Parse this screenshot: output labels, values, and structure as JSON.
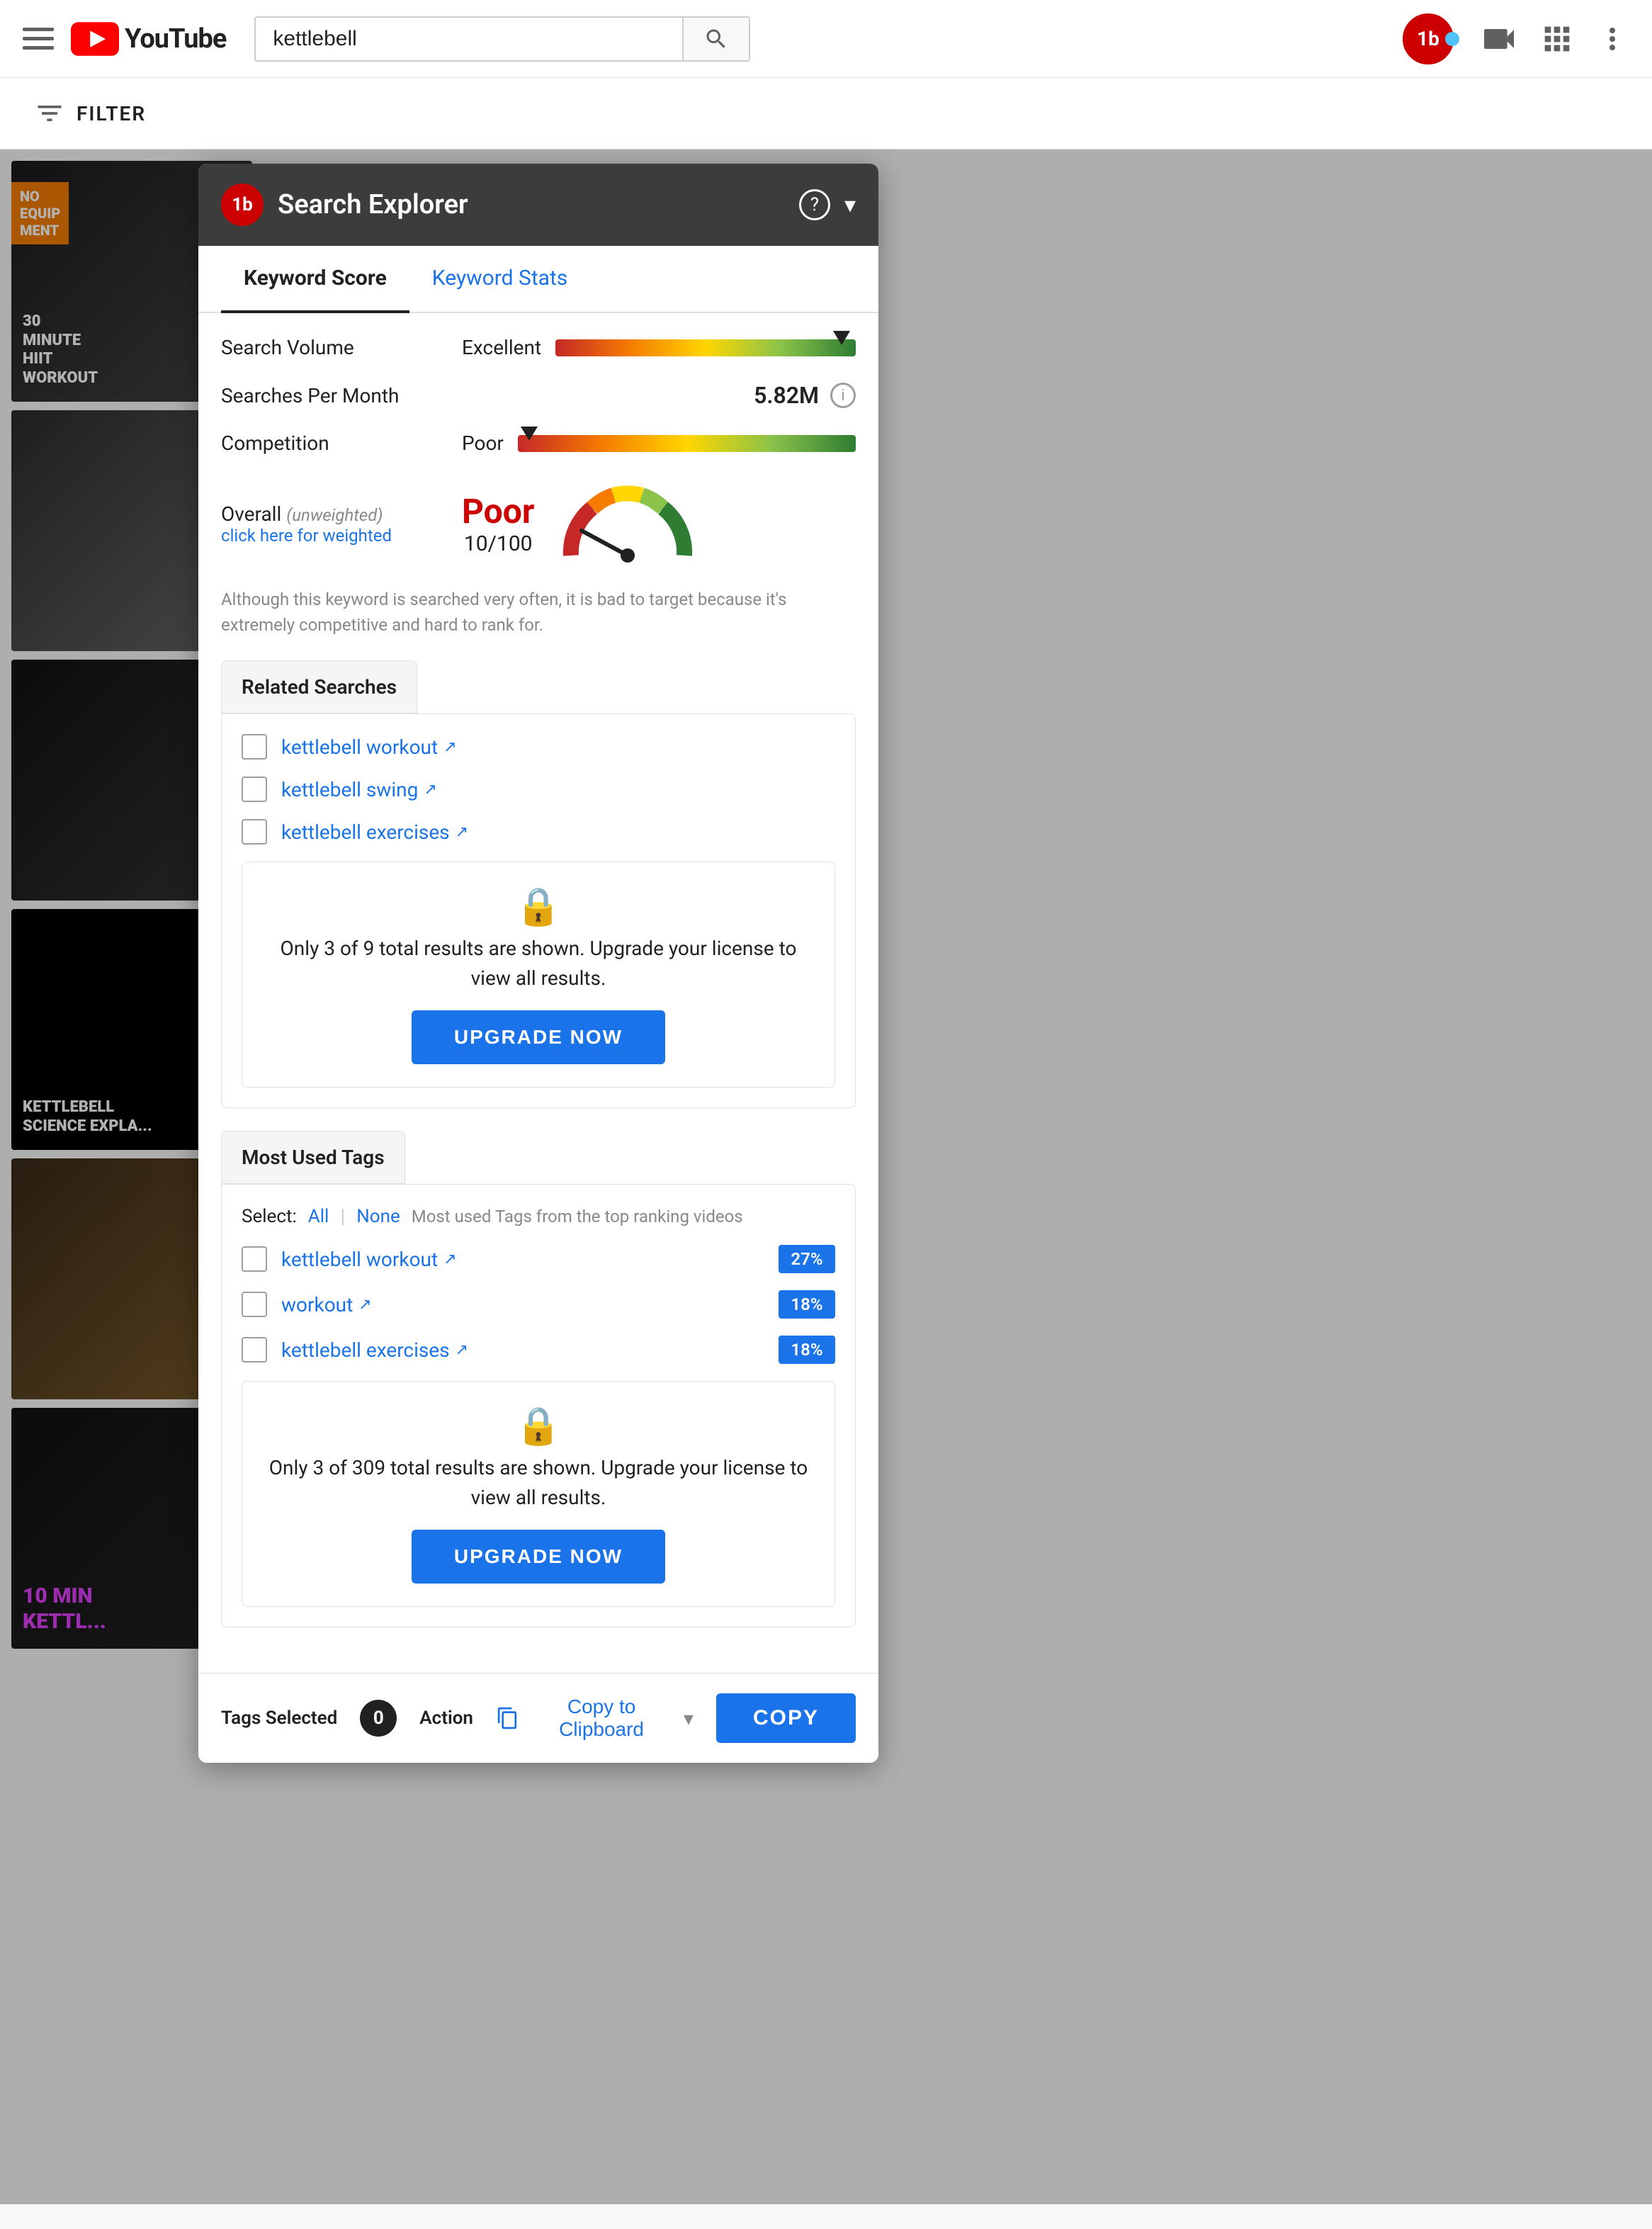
{
  "header": {
    "search_value": "kettlebell",
    "search_placeholder": "Search"
  },
  "filter": {
    "label": "FILTER"
  },
  "panel": {
    "title": "Search Explorer",
    "tabs": [
      {
        "label": "Keyword Score",
        "active": true
      },
      {
        "label": "Keyword Stats",
        "active": false
      }
    ],
    "keyword_score": {
      "search_volume_label": "Search Volume",
      "search_volume_rating": "Excellent",
      "searches_per_month_label": "Searches Per Month",
      "searches_per_month_value": "5.82M",
      "competition_label": "Competition",
      "competition_rating": "Poor",
      "overall_label": "Overall",
      "overall_unweighted": "(unweighted)",
      "overall_click_label": "click here for weighted",
      "overall_score_text": "Poor",
      "overall_score_number": "10/100",
      "description": "Although this keyword is searched very often, it is bad to target because it's extremely competitive and hard to rank for."
    },
    "related_searches": {
      "section_label": "Related Searches",
      "items": [
        {
          "label": "kettlebell workout"
        },
        {
          "label": "kettlebell swing"
        },
        {
          "label": "kettlebell exercises"
        }
      ],
      "upgrade_text": "Only 3 of 9 total results are shown. Upgrade your license to view all results.",
      "upgrade_btn": "UPGRADE NOW"
    },
    "most_used_tags": {
      "section_label": "Most Used Tags",
      "select_label": "Select:",
      "all_label": "All",
      "none_label": "None",
      "info_text": "Most used Tags from the top ranking videos",
      "items": [
        {
          "label": "kettlebell workout",
          "pct": "27%"
        },
        {
          "label": "workout",
          "pct": "18%"
        },
        {
          "label": "kettlebell exercises",
          "pct": "18%"
        }
      ],
      "upgrade_text": "Only 3 of 309 total results are shown. Upgrade your license to view all results.",
      "upgrade_btn": "UPGRADE NOW"
    },
    "action_bar": {
      "tags_selected_label": "Tags Selected",
      "count": "0",
      "action_label": "Action",
      "copy_to_clipboard": "Copy to Clipboard",
      "copy_btn": "COPY"
    }
  }
}
